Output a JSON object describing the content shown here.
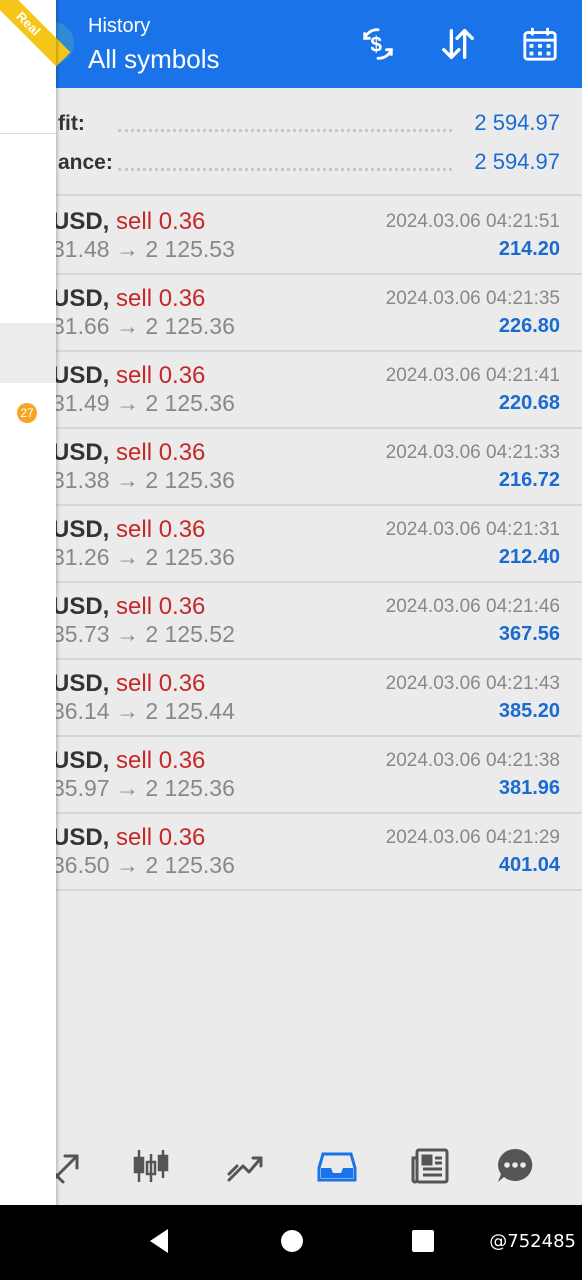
{
  "header": {
    "subtitle": "History",
    "title": "All symbols"
  },
  "summary": [
    {
      "label": "fit:",
      "value": "2 594.97"
    },
    {
      "label": "ance:",
      "value": "2 594.97"
    }
  ],
  "trades": [
    {
      "symbol": "USD,",
      "side": "sell 0.36",
      "price": "31.48 → 2 125.53",
      "time": "2024.03.06 04:21:51",
      "profit": "214.20"
    },
    {
      "symbol": "USD,",
      "side": "sell 0.36",
      "price": "31.66 → 2 125.36",
      "time": "2024.03.06 04:21:35",
      "profit": "226.80"
    },
    {
      "symbol": "USD,",
      "side": "sell 0.36",
      "price": "31.49 → 2 125.36",
      "time": "2024.03.06 04:21:41",
      "profit": "220.68"
    },
    {
      "symbol": "USD,",
      "side": "sell 0.36",
      "price": "31.38 → 2 125.36",
      "time": "2024.03.06 04:21:33",
      "profit": "216.72"
    },
    {
      "symbol": "USD,",
      "side": "sell 0.36",
      "price": "31.26 → 2 125.36",
      "time": "2024.03.06 04:21:31",
      "profit": "212.40"
    },
    {
      "symbol": "USD,",
      "side": "sell 0.36",
      "price": "35.73 → 2 125.52",
      "time": "2024.03.06 04:21:46",
      "profit": "367.56"
    },
    {
      "symbol": "USD,",
      "side": "sell 0.36",
      "price": "36.14 → 2 125.44",
      "time": "2024.03.06 04:21:43",
      "profit": "385.20"
    },
    {
      "symbol": "USD,",
      "side": "sell 0.36",
      "price": "35.97 → 2 125.36",
      "time": "2024.03.06 04:21:38",
      "profit": "381.96"
    },
    {
      "symbol": "USD,",
      "side": "sell 0.36",
      "price": "36.50 → 2 125.36",
      "time": "2024.03.06 04:21:29",
      "profit": "401.04"
    }
  ],
  "drawer": {
    "ribbon": "Real",
    "badge": "27"
  },
  "bottom_nav": [
    "quotes-icon",
    "chart-icon",
    "trade-icon",
    "history-icon",
    "news-icon",
    "chat-icon"
  ],
  "watermark": "@752485",
  "colors": {
    "header": "#1a73e8",
    "value_blue": "#1a6bd1",
    "sell_red": "#c62828"
  }
}
